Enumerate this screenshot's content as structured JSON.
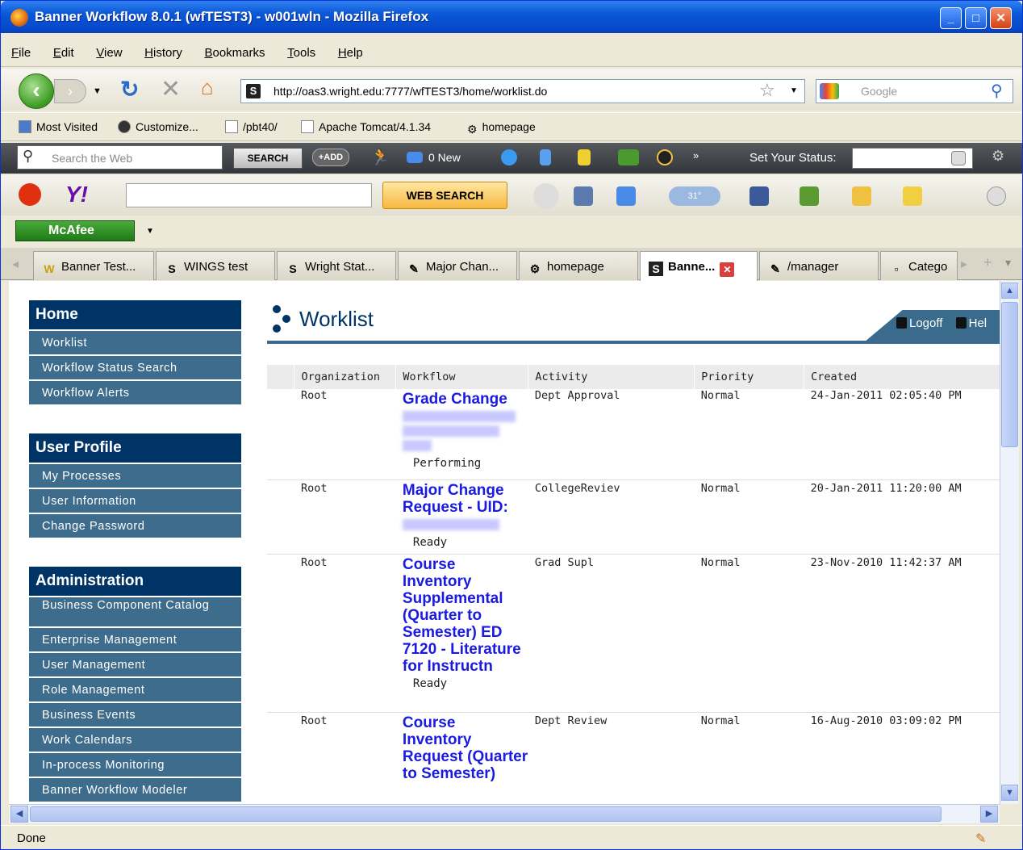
{
  "window": {
    "title": "Banner Workflow 8.0.1 (wfTEST3) - w001wln - Mozilla Firefox",
    "min": "_",
    "max": "□",
    "close": "✕"
  },
  "menu": [
    "File",
    "Edit",
    "View",
    "History",
    "Bookmarks",
    "Tools",
    "Help"
  ],
  "nav": {
    "url": "http://oas3.wright.edu:7777/wfTEST3/home/worklist.do",
    "search_placeholder": "Google"
  },
  "bookmarks": [
    "Most Visited",
    "Customize...",
    "/pbt40/",
    "Apache Tomcat/4.1.34",
    "homepage"
  ],
  "toolbar": {
    "search_placeholder": "Search the Web",
    "search_button": "SEARCH",
    "add_button": "+ADD",
    "mail": "0 New",
    "more": "»",
    "status_label": "Set Your Status:",
    "web_search": "WEB SEARCH",
    "badge": "31°"
  },
  "mcafee": {
    "label": "McAfee"
  },
  "tabs": [
    {
      "label": "Banner Test...",
      "icon": "W"
    },
    {
      "label": "WINGS test",
      "icon": "S"
    },
    {
      "label": "Wright Stat...",
      "icon": "S"
    },
    {
      "label": "Major Chan...",
      "icon": "✎"
    },
    {
      "label": "homepage",
      "icon": "⚙"
    },
    {
      "label": "Banne...",
      "icon": "S"
    },
    {
      "label": "/manager",
      "icon": "✎"
    },
    {
      "label": "Catego",
      "icon": "▫"
    }
  ],
  "sidebar": {
    "home": {
      "header": "Home",
      "items": [
        "Worklist",
        "Workflow Status Search",
        "Workflow Alerts"
      ]
    },
    "profile": {
      "header": "User Profile",
      "items": [
        "My Processes",
        "User Information",
        "Change Password"
      ]
    },
    "admin": {
      "header": "Administration",
      "items": [
        "Business Component Catalog",
        "Enterprise Management",
        "User Management",
        "Role Management",
        "Business Events",
        "Work Calendars",
        "In-process Monitoring",
        "Banner Workflow Modeler"
      ]
    }
  },
  "page": {
    "title": "Worklist",
    "logoff": "Logoff",
    "help": "Hel"
  },
  "grid": {
    "columns": [
      "Organization",
      "Workflow",
      "Activity",
      "Priority",
      "Created"
    ],
    "rows": [
      {
        "org": "Root",
        "workflow": "Grade Change",
        "state": "Performing",
        "activity": "Dept Approval",
        "priority": "Normal",
        "created": "24-Jan-2011 02:05:40 PM"
      },
      {
        "org": "Root",
        "workflow": "Major Change Request - UID:",
        "state": "Ready",
        "activity": "CollegeReviev",
        "priority": "Normal",
        "created": "20-Jan-2011 11:20:00 AM"
      },
      {
        "org": "Root",
        "workflow": "Course Inventory Supplemental (Quarter to Semester) ED 7120 - Literature for Instructn",
        "state": "Ready",
        "activity": "Grad Supl",
        "priority": "Normal",
        "created": "23-Nov-2010 11:42:37 AM"
      },
      {
        "org": "Root",
        "workflow": "Course Inventory Request (Quarter to Semester)",
        "state": "",
        "activity": "Dept Review",
        "priority": "Normal",
        "created": "16-Aug-2010 03:09:02 PM"
      }
    ]
  },
  "status": {
    "text": "Done"
  }
}
